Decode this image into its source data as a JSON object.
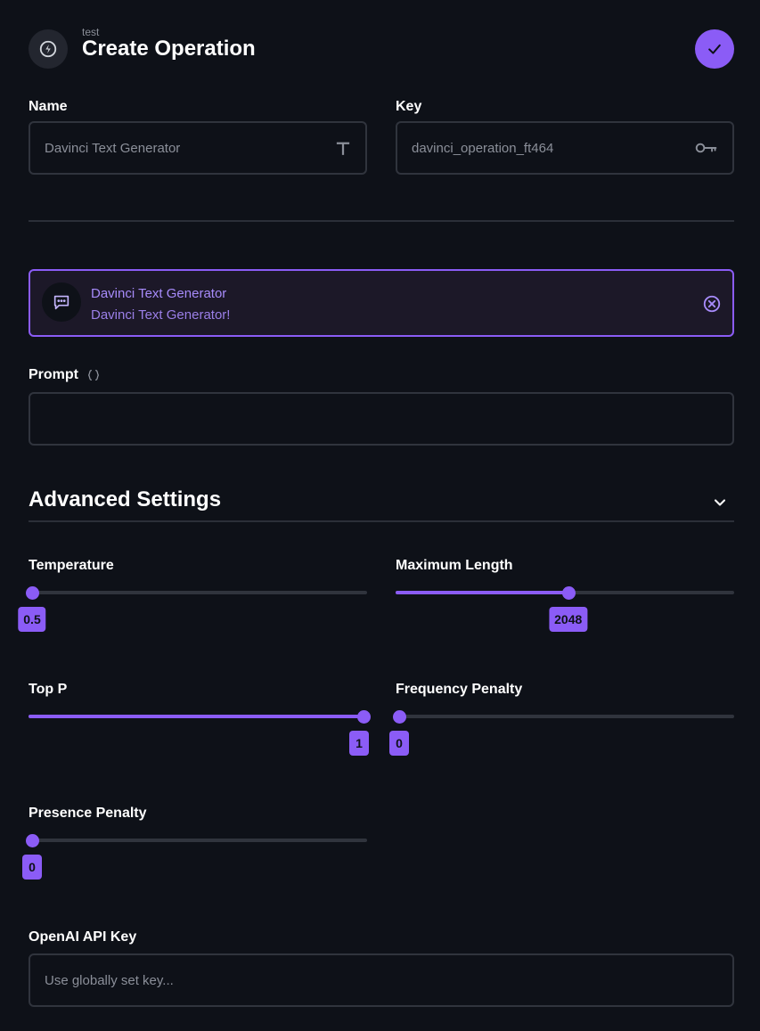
{
  "header": {
    "subtitle": "test",
    "title": "Create Operation"
  },
  "form": {
    "name_label": "Name",
    "name_placeholder": "Davinci Text Generator",
    "key_label": "Key",
    "key_placeholder": "davinci_operation_ft464"
  },
  "selected_operation": {
    "title": "Davinci Text Generator",
    "description": "Davinci Text Generator!"
  },
  "prompt": {
    "label": "Prompt",
    "value": ""
  },
  "advanced": {
    "title": "Advanced Settings",
    "sliders": [
      {
        "label": "Temperature",
        "value": "0.5",
        "fraction": 0.0
      },
      {
        "label": "Maximum Length",
        "value": "2048",
        "fraction": 0.51
      },
      {
        "label": "Top P",
        "value": "1",
        "fraction": 1.0
      },
      {
        "label": "Frequency Penalty",
        "value": "0",
        "fraction": 0.0
      },
      {
        "label": "Presence Penalty",
        "value": "0",
        "fraction": 0.0
      }
    ]
  },
  "api_key": {
    "label": "OpenAI API Key",
    "placeholder": "Use globally set key..."
  },
  "colors": {
    "accent": "#8b5cf6",
    "background": "#0e1118",
    "border": "#30343d"
  },
  "icons": {
    "header": "lightning-icon",
    "confirm": "check-icon",
    "name_field": "text-t-icon",
    "key_field": "key-icon",
    "operation": "chat-bubble-icon",
    "remove": "close-circle-icon",
    "prompt": "braces-icon",
    "collapse": "chevron-down-icon"
  }
}
